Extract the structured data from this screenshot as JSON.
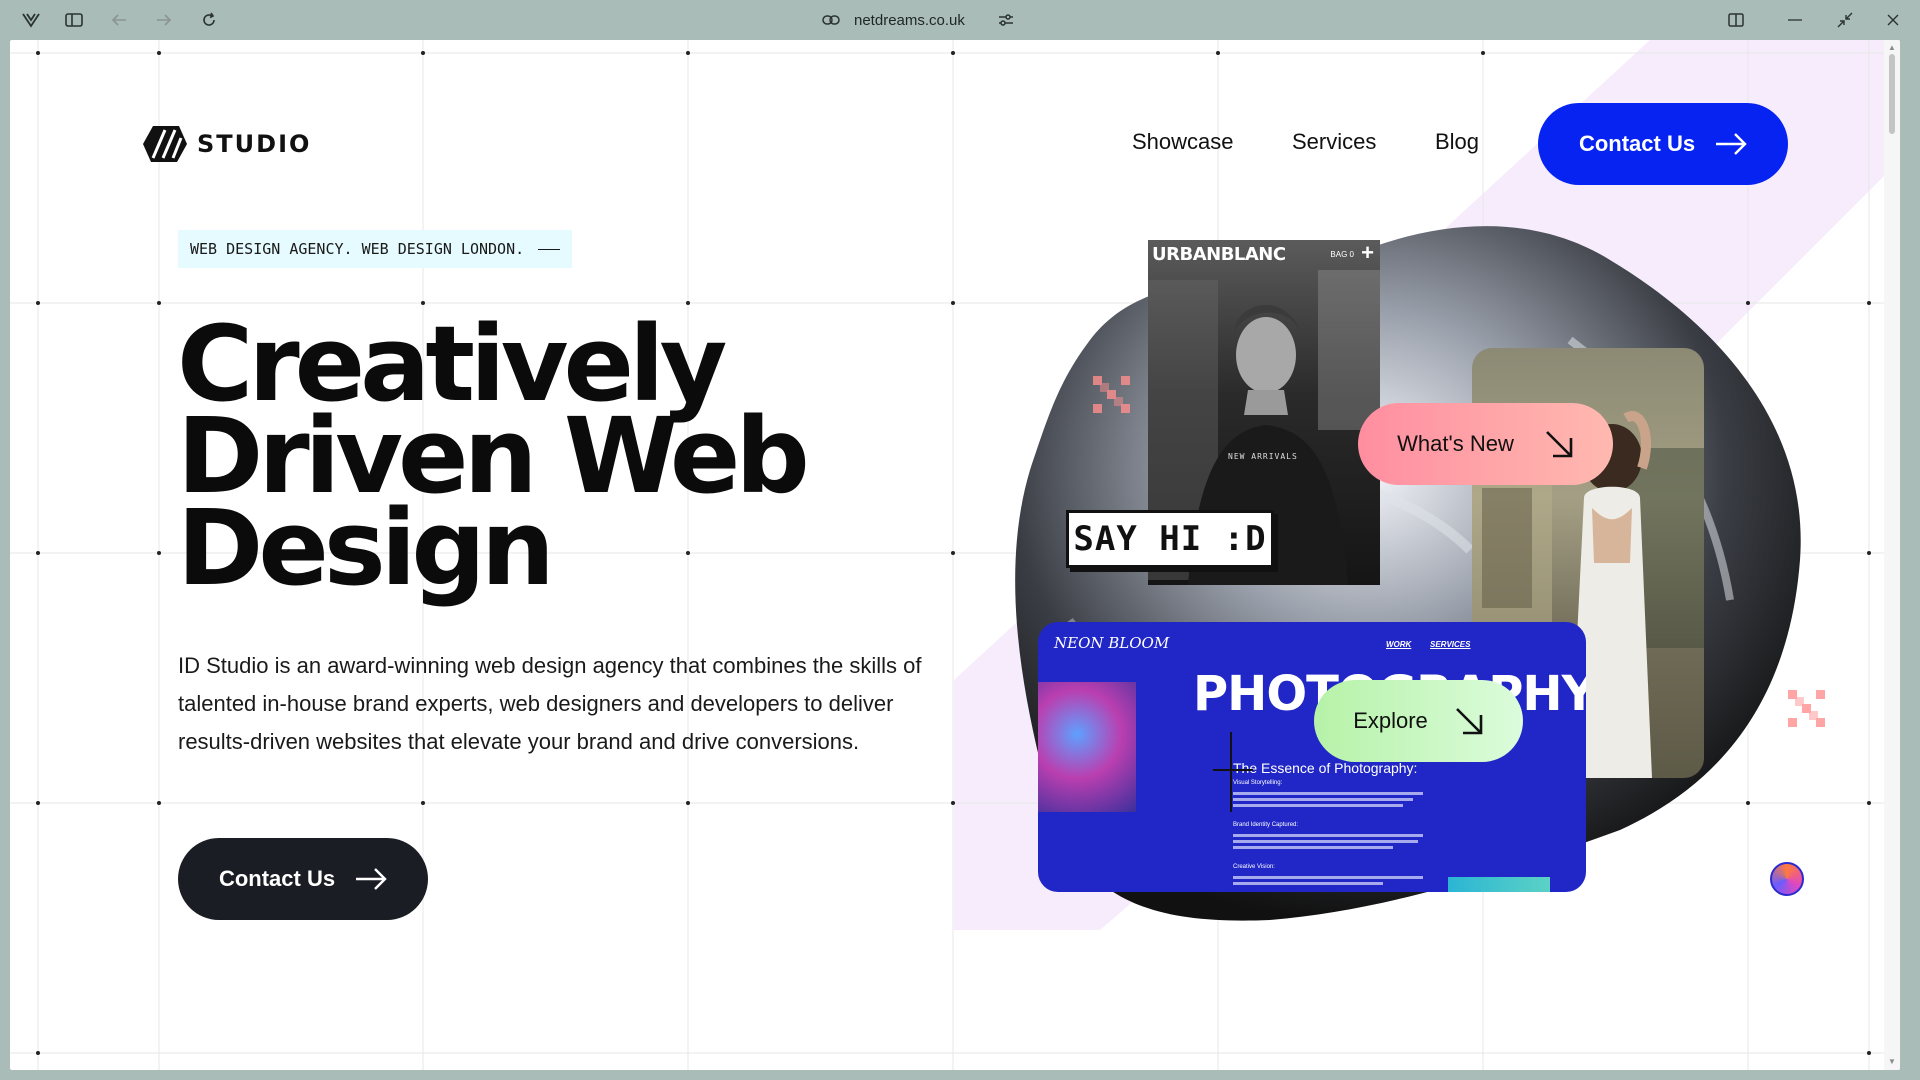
{
  "browser": {
    "url": "netdreams.co.uk",
    "icons": [
      "app-menu-icon",
      "sidebar-toggle-icon",
      "back-icon",
      "forward-icon",
      "reload-icon",
      "link-icon",
      "tune-icon",
      "split-view-icon",
      "minimize-icon",
      "restore-icon",
      "close-icon"
    ]
  },
  "header": {
    "logo_text": "STUDIO",
    "nav": [
      "Showcase",
      "Services",
      "Blog"
    ],
    "cta_label": "Contact Us"
  },
  "hero": {
    "tagline": "WEB DESIGN AGENCY. WEB DESIGN LONDON.",
    "headline": [
      "Creatively",
      "Driven Web",
      "Design"
    ],
    "description": "ID Studio is an award-winning web design agency that combines the skills of talented in-house brand experts, web designers and developers to deliver results-driven websites that elevate your brand and drive conversions.",
    "cta_label": "Contact Us"
  },
  "collage": {
    "urban": {
      "brand": "URBANBLANC",
      "bag": "BAG 0",
      "caption": "NEW ARRIVALS"
    },
    "bloom": {
      "logo": "NEON BLOOM",
      "nav_work": "WORK",
      "nav_services": "SERVICES",
      "headline": "PHOTOGRAPHY",
      "subhead": "The Essence of Photography:",
      "sections": [
        "Visual Storytelling:",
        "Brand Identity Captured:",
        "Creative Vision:"
      ]
    },
    "pill_new": "What's New",
    "pill_explore": "Explore",
    "sayhi": "SAY HI :D"
  },
  "colors": {
    "primary_blue": "#0623f2",
    "dark_button": "#1b1d24",
    "tag_bg": "#e5fbff",
    "pink_pill": "#ff8ea0",
    "green_pill": "#b6f2a8",
    "bloom_blue": "#2127c6",
    "lavender": "#f3e6fb"
  }
}
